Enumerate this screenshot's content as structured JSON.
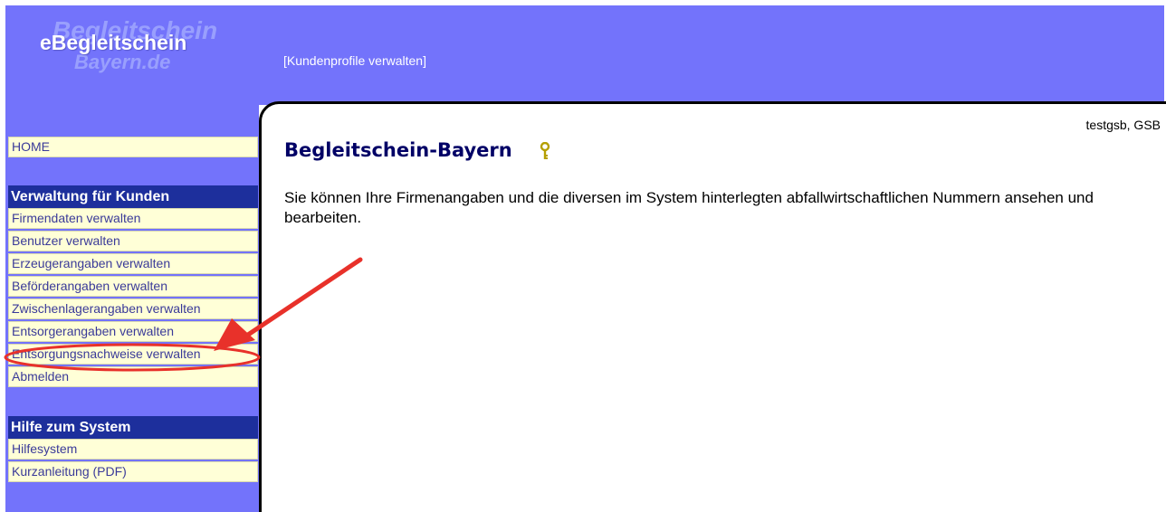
{
  "header": {
    "logo_text": "eBegleitschein",
    "logo_ghost_top": "Begleitschein",
    "logo_ghost_bottom": "Bayern.de",
    "section_title": "[Kundenprofile verwalten]"
  },
  "user_info": "testgsb, GSB",
  "main": {
    "title": "Begleitschein-Bayern",
    "help_icon": "key-icon",
    "intro": "Sie können Ihre Firmenangaben und die diversen im System hinterlegten abfallwirtschaftlichen Nummern ansehen und bearbeiten."
  },
  "sidebar": {
    "home": "HOME",
    "group1": {
      "heading": "Verwaltung für Kunden",
      "items": [
        "Firmendaten verwalten",
        "Benutzer verwalten",
        "Erzeugerangaben verwalten",
        "Beförderangaben verwalten",
        "Zwischenlagerangaben verwalten",
        "Entsorgerangaben verwalten",
        "Entsorgungsnachweise verwalten",
        "Abmelden"
      ]
    },
    "group2": {
      "heading": "Hilfe zum System",
      "items": [
        "Hilfesystem",
        "Kurzanleitung (PDF)"
      ]
    }
  },
  "colors": {
    "header_bg": "#7373fb",
    "nav_heading_bg": "#1d2f9c",
    "nav_item_bg": "#ffffd7",
    "annotation": "#e8312a"
  }
}
